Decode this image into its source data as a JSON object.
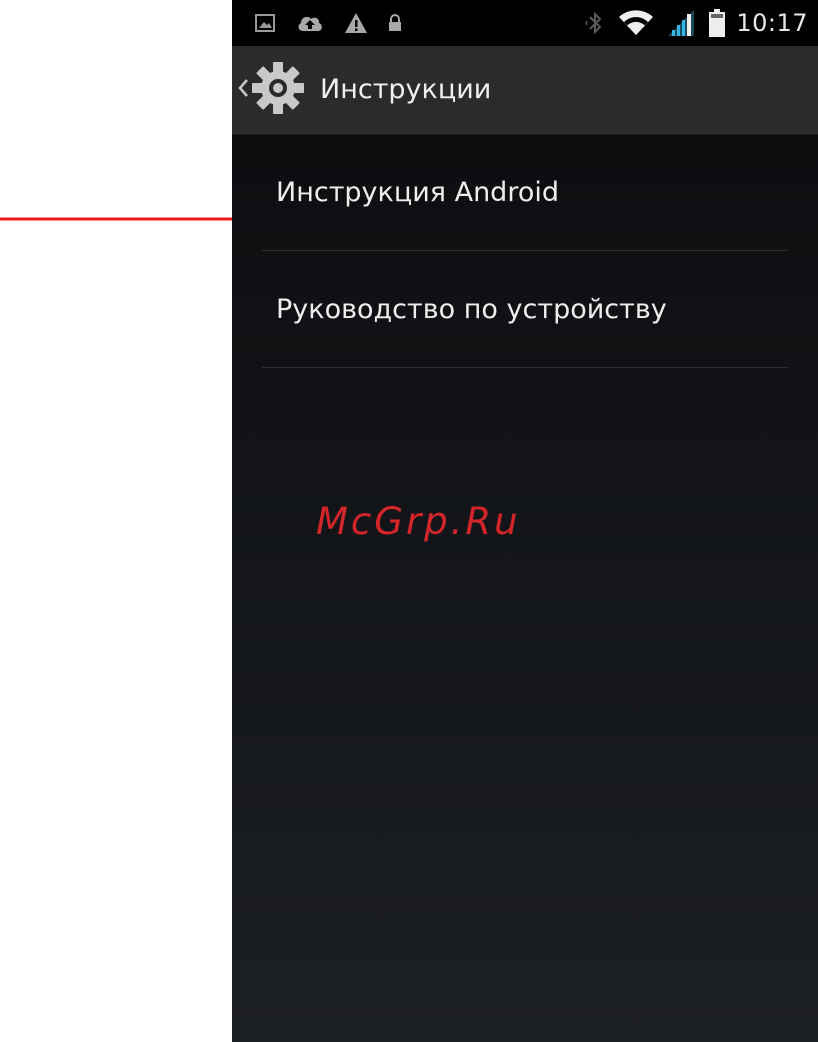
{
  "status_bar": {
    "left_icons": [
      "image-icon",
      "cloud-upload-icon",
      "warning-icon",
      "lock-icon"
    ],
    "right_icons": [
      "bluetooth-icon",
      "wifi-icon",
      "signal-icon",
      "battery-icon"
    ],
    "time": "10:17"
  },
  "action_bar": {
    "title": "Инструкции",
    "icon": "gear-icon"
  },
  "list": {
    "items": [
      {
        "label": "Инструкция Android"
      },
      {
        "label": "Руководство по устройству"
      }
    ]
  },
  "watermark": "McGrp.Ru",
  "colors": {
    "background": "#111316",
    "action_bar": "#2a2b2d",
    "text": "#eeeeee",
    "annotation_arrow": "#ee1c1c",
    "watermark": "#d4262a",
    "signal_accent": "#33b5e5"
  }
}
